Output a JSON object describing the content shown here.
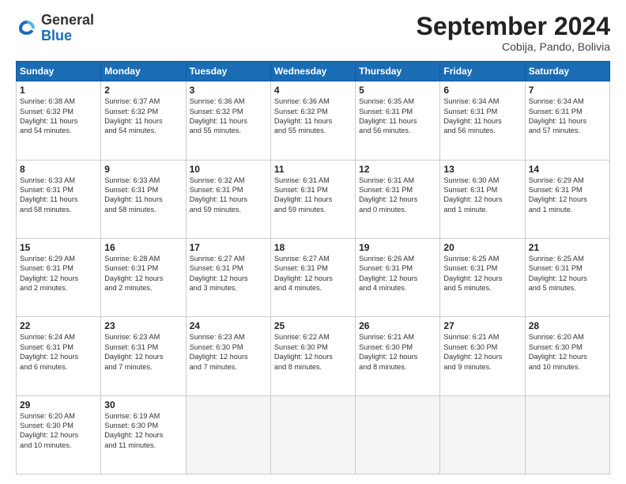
{
  "logo": {
    "general": "General",
    "blue": "Blue"
  },
  "header": {
    "month": "September 2024",
    "location": "Cobija, Pando, Bolivia"
  },
  "days_of_week": [
    "Sunday",
    "Monday",
    "Tuesday",
    "Wednesday",
    "Thursday",
    "Friday",
    "Saturday"
  ],
  "weeks": [
    [
      {
        "day": "1",
        "info": "Sunrise: 6:38 AM\nSunset: 6:32 PM\nDaylight: 11 hours\nand 54 minutes."
      },
      {
        "day": "2",
        "info": "Sunrise: 6:37 AM\nSunset: 6:32 PM\nDaylight: 11 hours\nand 54 minutes."
      },
      {
        "day": "3",
        "info": "Sunrise: 6:36 AM\nSunset: 6:32 PM\nDaylight: 11 hours\nand 55 minutes."
      },
      {
        "day": "4",
        "info": "Sunrise: 6:36 AM\nSunset: 6:32 PM\nDaylight: 11 hours\nand 55 minutes."
      },
      {
        "day": "5",
        "info": "Sunrise: 6:35 AM\nSunset: 6:31 PM\nDaylight: 11 hours\nand 56 minutes."
      },
      {
        "day": "6",
        "info": "Sunrise: 6:34 AM\nSunset: 6:31 PM\nDaylight: 11 hours\nand 56 minutes."
      },
      {
        "day": "7",
        "info": "Sunrise: 6:34 AM\nSunset: 6:31 PM\nDaylight: 11 hours\nand 57 minutes."
      }
    ],
    [
      {
        "day": "8",
        "info": "Sunrise: 6:33 AM\nSunset: 6:31 PM\nDaylight: 11 hours\nand 58 minutes."
      },
      {
        "day": "9",
        "info": "Sunrise: 6:33 AM\nSunset: 6:31 PM\nDaylight: 11 hours\nand 58 minutes."
      },
      {
        "day": "10",
        "info": "Sunrise: 6:32 AM\nSunset: 6:31 PM\nDaylight: 11 hours\nand 59 minutes."
      },
      {
        "day": "11",
        "info": "Sunrise: 6:31 AM\nSunset: 6:31 PM\nDaylight: 11 hours\nand 59 minutes."
      },
      {
        "day": "12",
        "info": "Sunrise: 6:31 AM\nSunset: 6:31 PM\nDaylight: 12 hours\nand 0 minutes."
      },
      {
        "day": "13",
        "info": "Sunrise: 6:30 AM\nSunset: 6:31 PM\nDaylight: 12 hours\nand 1 minute."
      },
      {
        "day": "14",
        "info": "Sunrise: 6:29 AM\nSunset: 6:31 PM\nDaylight: 12 hours\nand 1 minute."
      }
    ],
    [
      {
        "day": "15",
        "info": "Sunrise: 6:29 AM\nSunset: 6:31 PM\nDaylight: 12 hours\nand 2 minutes."
      },
      {
        "day": "16",
        "info": "Sunrise: 6:28 AM\nSunset: 6:31 PM\nDaylight: 12 hours\nand 2 minutes."
      },
      {
        "day": "17",
        "info": "Sunrise: 6:27 AM\nSunset: 6:31 PM\nDaylight: 12 hours\nand 3 minutes."
      },
      {
        "day": "18",
        "info": "Sunrise: 6:27 AM\nSunset: 6:31 PM\nDaylight: 12 hours\nand 4 minutes."
      },
      {
        "day": "19",
        "info": "Sunrise: 6:26 AM\nSunset: 6:31 PM\nDaylight: 12 hours\nand 4 minutes."
      },
      {
        "day": "20",
        "info": "Sunrise: 6:25 AM\nSunset: 6:31 PM\nDaylight: 12 hours\nand 5 minutes."
      },
      {
        "day": "21",
        "info": "Sunrise: 6:25 AM\nSunset: 6:31 PM\nDaylight: 12 hours\nand 5 minutes."
      }
    ],
    [
      {
        "day": "22",
        "info": "Sunrise: 6:24 AM\nSunset: 6:31 PM\nDaylight: 12 hours\nand 6 minutes."
      },
      {
        "day": "23",
        "info": "Sunrise: 6:23 AM\nSunset: 6:31 PM\nDaylight: 12 hours\nand 7 minutes."
      },
      {
        "day": "24",
        "info": "Sunrise: 6:23 AM\nSunset: 6:30 PM\nDaylight: 12 hours\nand 7 minutes."
      },
      {
        "day": "25",
        "info": "Sunrise: 6:22 AM\nSunset: 6:30 PM\nDaylight: 12 hours\nand 8 minutes."
      },
      {
        "day": "26",
        "info": "Sunrise: 6:21 AM\nSunset: 6:30 PM\nDaylight: 12 hours\nand 8 minutes."
      },
      {
        "day": "27",
        "info": "Sunrise: 6:21 AM\nSunset: 6:30 PM\nDaylight: 12 hours\nand 9 minutes."
      },
      {
        "day": "28",
        "info": "Sunrise: 6:20 AM\nSunset: 6:30 PM\nDaylight: 12 hours\nand 10 minutes."
      }
    ],
    [
      {
        "day": "29",
        "info": "Sunrise: 6:20 AM\nSunset: 6:30 PM\nDaylight: 12 hours\nand 10 minutes."
      },
      {
        "day": "30",
        "info": "Sunrise: 6:19 AM\nSunset: 6:30 PM\nDaylight: 12 hours\nand 11 minutes."
      },
      {
        "day": "",
        "info": ""
      },
      {
        "day": "",
        "info": ""
      },
      {
        "day": "",
        "info": ""
      },
      {
        "day": "",
        "info": ""
      },
      {
        "day": "",
        "info": ""
      }
    ]
  ]
}
